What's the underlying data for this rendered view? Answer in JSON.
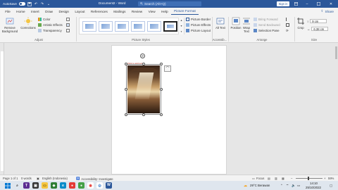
{
  "titlebar": {
    "autosave_label": "AutoSave",
    "autosave_state": "Off",
    "doc_title": "Document2 - Word",
    "search_placeholder": "Search (Alt+Q)",
    "sign_in": "Sign in"
  },
  "tabs": [
    {
      "label": "File"
    },
    {
      "label": "Home"
    },
    {
      "label": "Insert"
    },
    {
      "label": "Draw"
    },
    {
      "label": "Design"
    },
    {
      "label": "Layout"
    },
    {
      "label": "References"
    },
    {
      "label": "Mailings"
    },
    {
      "label": "Review"
    },
    {
      "label": "View"
    },
    {
      "label": "Help"
    },
    {
      "label": "Picture Format"
    }
  ],
  "share_label": "Share",
  "ribbon": {
    "remove_bg": "Remove Background",
    "corrections": "Corrections",
    "color": "Color",
    "artistic": "Artistic Effects",
    "transparency": "Transparency",
    "adjust_label": "Adjust",
    "picture_styles_label": "Picture Styles",
    "picture_border": "Picture Border",
    "picture_effects": "Picture Effects",
    "picture_layout": "Picture Layout",
    "alt_text": "Alt Text",
    "accessibility_label": "Accessib...",
    "position": "Position",
    "wrap_text": "Wrap Text",
    "bring_forward": "Bring Forward",
    "send_backward": "Send Backward",
    "selection_pane": "Selection Pane",
    "arrange_label": "Arrange",
    "crop": "Crop",
    "height": "9 cm",
    "width": "6.38 cm",
    "size_label": "Size"
  },
  "picture_caption": "Click to add text",
  "statusbar": {
    "page": "Page 1 of 1",
    "words": "0 words",
    "language": "English (Indonesia)",
    "accessibility": "Accessibility: Investigate",
    "focus": "Focus",
    "zoom": "59%"
  },
  "taskbar": {
    "weather": "29°C  Berawan",
    "time": "14:10",
    "date": "25/10/2022"
  }
}
